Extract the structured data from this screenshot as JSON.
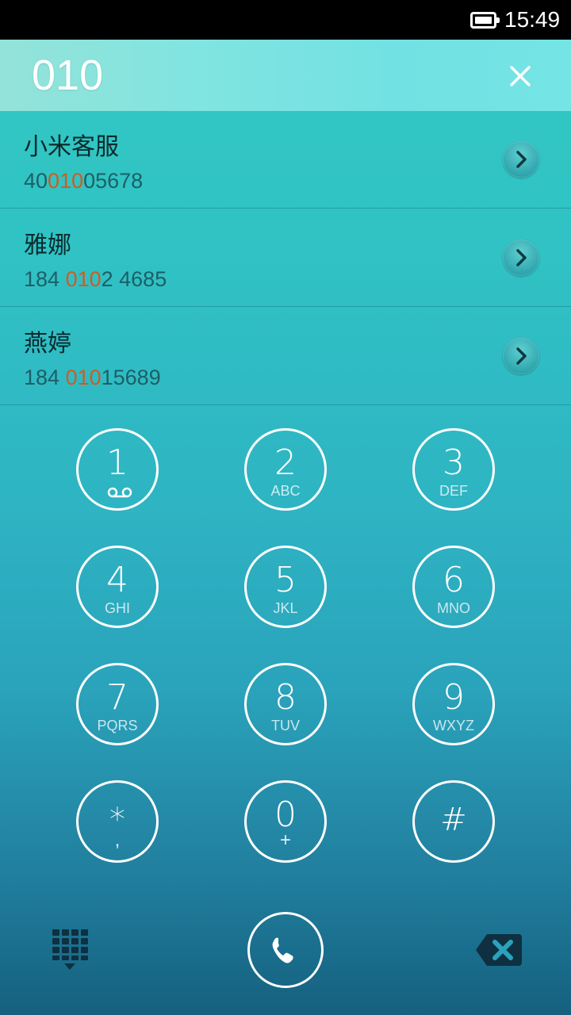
{
  "status_bar": {
    "time": "15:49",
    "battery_icon": "battery-full-icon"
  },
  "dialer": {
    "input_value": "010",
    "clear_icon": "close-icon"
  },
  "results": [
    {
      "name": "小米客服",
      "number_parts": [
        {
          "text": "40",
          "highlight": false
        },
        {
          "text": "010",
          "highlight": true
        },
        {
          "text": "05678",
          "highlight": false
        }
      ]
    },
    {
      "name": "雅娜",
      "number_parts": [
        {
          "text": "184 ",
          "highlight": false
        },
        {
          "text": "010",
          "highlight": true
        },
        {
          "text": "2 4685",
          "highlight": false
        }
      ]
    },
    {
      "name": "燕婷",
      "number_parts": [
        {
          "text": "184 ",
          "highlight": false
        },
        {
          "text": "010",
          "highlight": true
        },
        {
          "text": "15689",
          "highlight": false
        }
      ]
    }
  ],
  "keypad": {
    "keys": [
      {
        "digit": "1",
        "letters": "",
        "icon": "voicemail-icon"
      },
      {
        "digit": "2",
        "letters": "ABC"
      },
      {
        "digit": "3",
        "letters": "DEF"
      },
      {
        "digit": "4",
        "letters": "GHI"
      },
      {
        "digit": "5",
        "letters": "JKL"
      },
      {
        "digit": "6",
        "letters": "MNO"
      },
      {
        "digit": "7",
        "letters": "PQRS"
      },
      {
        "digit": "8",
        "letters": "TUV"
      },
      {
        "digit": "9",
        "letters": "WXYZ"
      },
      {
        "digit": "*",
        "letters": ","
      },
      {
        "digit": "0",
        "letters": "+"
      },
      {
        "digit": "#",
        "letters": ""
      }
    ]
  },
  "bottom_bar": {
    "keypad_toggle_icon": "dialpad-icon",
    "call_icon": "phone-icon",
    "backspace_icon": "backspace-icon"
  },
  "colors": {
    "highlight": "#d45a1e",
    "header_bg": "#7ee3e0",
    "list_bg": "#32c9c2",
    "keypad_bottom": "#15607f"
  }
}
